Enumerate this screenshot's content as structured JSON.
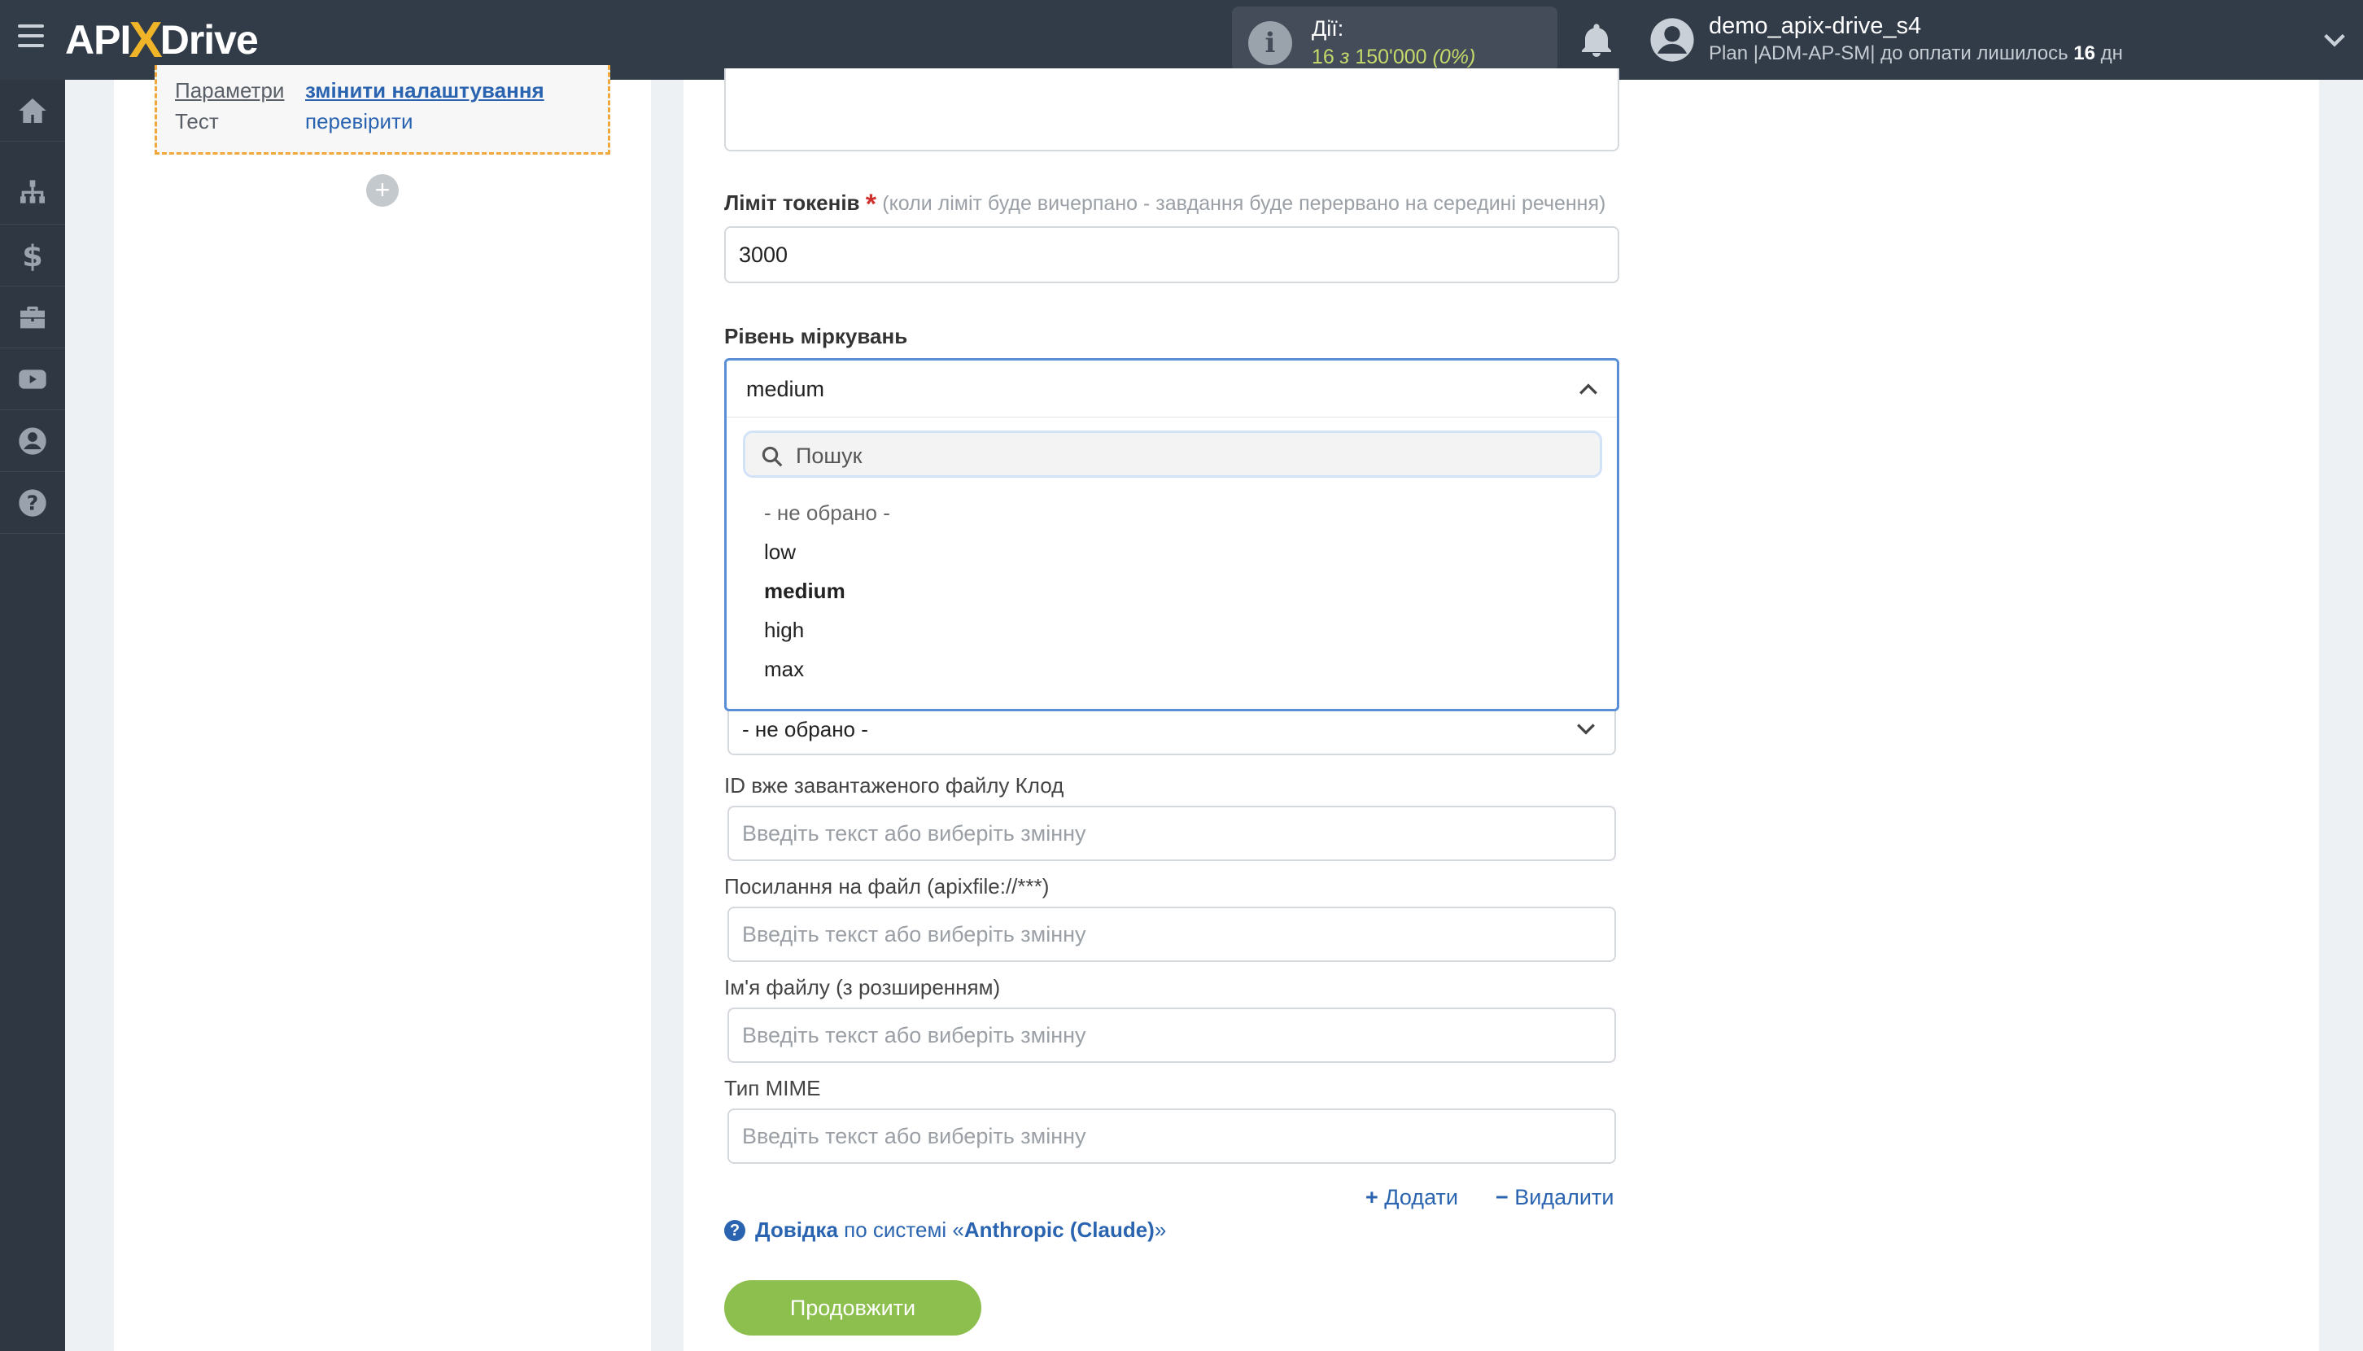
{
  "header": {
    "logo_left": "API",
    "logo_x": "X",
    "logo_right": "Drive",
    "actions_title": "Дії:",
    "actions_count": "16",
    "actions_of": "з",
    "actions_limit": "150'000",
    "actions_percent": "(0%)",
    "username": "demo_apix-drive_s4",
    "plan_text": "Plan |ADM-AP-SM| до оплати лишилось",
    "plan_days": "16",
    "plan_days_unit": "дн"
  },
  "sidebar": {
    "items": [
      "home-icon",
      "sitemap-icon",
      "dollar-icon",
      "briefcase-icon",
      "youtube-icon",
      "user-icon",
      "help-icon"
    ]
  },
  "step": {
    "params_label": "Параметри",
    "params_link": "змінити налаштування",
    "test_label": "Тест",
    "test_link": "перевірити",
    "add_symbol": "+"
  },
  "form": {
    "token_limit_label": "Ліміт токенів",
    "token_limit_required": "*",
    "token_limit_hint": "(коли ліміт буде вичерпано - завдання буде перервано на середині речення)",
    "token_limit_value": "3000",
    "reasoning_label": "Рівень міркувань",
    "reasoning_selected": "medium",
    "search_placeholder": "Пошук",
    "options": [
      "- не обрано -",
      "low",
      "medium",
      "high",
      "max"
    ],
    "hidden_select_value": "- не обрано -",
    "file_id_label": "ID вже завантаженого файлу Клод",
    "file_link_label": "Посилання на файл (apixfile://***)",
    "file_name_label": "Ім'я файлу (з розширенням)",
    "mime_label": "Тип MIME",
    "input_placeholder": "Введіть текст або виберіть змінну",
    "add_label": "Додати",
    "remove_label": "Видалити",
    "help_bold": "Довідка",
    "help_text": "по системі «",
    "help_system": "Anthropic (Claude)",
    "help_close": "»",
    "continue_label": "Продовжити"
  },
  "colors": {
    "topbar": "#323b48",
    "sidebar": "#2f3742",
    "accent_green": "#8cbf4e",
    "link_blue": "#2a64b0",
    "step_border": "#f0a73c",
    "dropdown_border": "#5a8fd6"
  }
}
